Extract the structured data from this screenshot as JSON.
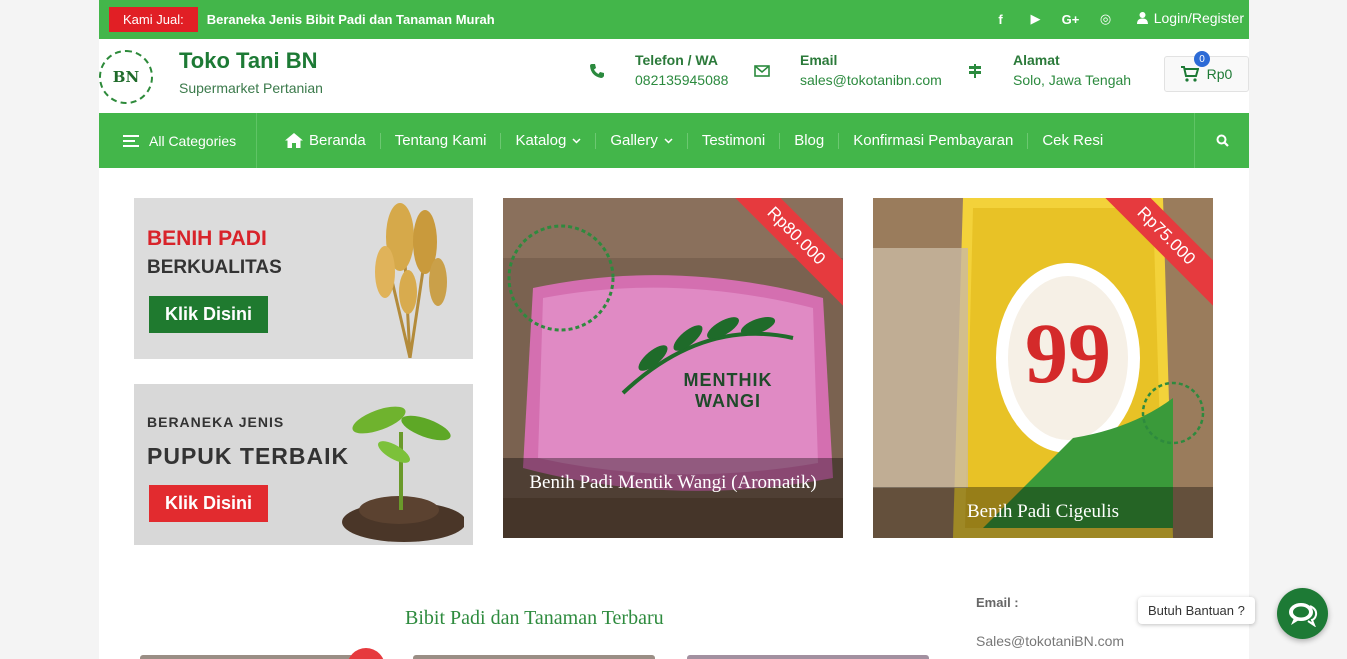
{
  "topbar": {
    "badge": "Kami Jual:",
    "ticker": "Beraneka Jenis Bibit Padi dan Tanaman Murah",
    "social_icons": [
      "facebook-icon",
      "youtube-icon",
      "google-plus-icon",
      "instagram-icon"
    ],
    "social_glyphs": [
      "f",
      "▶",
      "G+",
      "◎"
    ],
    "login": "Login/Register"
  },
  "header": {
    "logo_text": "BN",
    "brand_name": "Toko Tani BN",
    "tagline": "Supermarket Pertanian",
    "phone_label": "Telefon / WA",
    "phone": "082135945088",
    "email_label": "Email",
    "email": "sales@tokotanibn.com",
    "address_label": "Alamat",
    "address": "Solo, Jawa Tengah",
    "cart_count": "0",
    "cart_total": "Rp0"
  },
  "nav": {
    "all_categories": "All Categories",
    "items": [
      {
        "label": "Beranda"
      },
      {
        "label": "Tentang Kami"
      },
      {
        "label": "Katalog"
      },
      {
        "label": "Gallery"
      },
      {
        "label": "Testimoni"
      },
      {
        "label": "Blog"
      },
      {
        "label": "Konfirmasi Pembayaran"
      },
      {
        "label": "Cek Resi"
      }
    ]
  },
  "promos": [
    {
      "line1": "BENIH PADI",
      "line2": "BERKUALITAS",
      "button": "Klik Disini"
    },
    {
      "line1": "BERANEKA JENIS",
      "line2": "PUPUK TERBAIK",
      "button": "Klik Disini"
    }
  ],
  "products": [
    {
      "price": "Rp80.000",
      "name": "Benih Padi Mentik Wangi (Aromatik)",
      "bag_text": "MENTHIK WANGI"
    },
    {
      "price": "Rp75.000",
      "name": "Benih Padi Cigeulis",
      "bag_text": "99"
    }
  ],
  "section_title": "Bibit Padi dan Tanaman Terbaru",
  "sidebar": {
    "email_label": "Email :",
    "email_value": "Sales@tokotaniBN.com"
  },
  "chat": {
    "prompt": "Butuh Bantuan ?"
  },
  "colors": {
    "brand_green": "#43b64a",
    "dark_green": "#1d7a35",
    "accent_red": "#e11f25"
  }
}
